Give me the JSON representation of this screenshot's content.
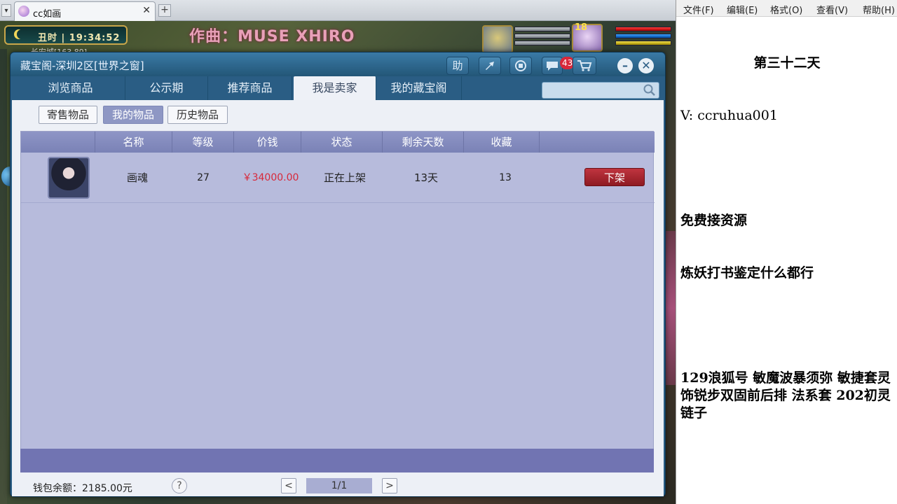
{
  "browser": {
    "tab_title": "cc如画",
    "tab_close": "✕",
    "new_tab": "+"
  },
  "game": {
    "clock": "丑时 | 19:34:52",
    "location": "长安城[163,89]",
    "banner": "作曲：MUSE XHIRO",
    "player_level": "18"
  },
  "window": {
    "title": "藏宝阁-深圳2区[世界之窗]",
    "toolbar": {
      "help_label": "助",
      "chat_badge": "43"
    },
    "tabs": [
      "浏览商品",
      "公示期",
      "推荐商品",
      "我是卖家",
      "我的藏宝阁"
    ],
    "active_tab": "我是卖家",
    "search_placeholder": "",
    "subtabs": [
      "寄售物品",
      "我的物品",
      "历史物品"
    ],
    "active_subtab": "我的物品",
    "table": {
      "headers": [
        "名称",
        "等级",
        "价钱",
        "状态",
        "剩余天数",
        "收藏"
      ],
      "rows": [
        {
          "name": "画魂",
          "level": "27",
          "price": "￥34000.00",
          "status": "正在上架",
          "days_left": "13天",
          "favorites": "13",
          "action": "下架"
        }
      ]
    },
    "footer": {
      "wallet": "钱包余额：2185.00元",
      "help": "?",
      "prev": "<",
      "page": "1/1",
      "next": ">"
    }
  },
  "notepad": {
    "menu": [
      "文件(F)",
      "编辑(E)",
      "格式(O)",
      "查看(V)",
      "帮助(H)"
    ],
    "title": "第三十二天",
    "lines": [
      "V: ccruhua001",
      "",
      "免费接资源",
      "炼妖打书鉴定什么都行",
      "",
      "129浪狐号 敏魔波暴须弥 敏捷套灵饰锐步双固前后排 法系套 202初灵链子"
    ]
  },
  "colors": {
    "price_red": "#d8283a",
    "delist_red": "#b02a35",
    "window_blue": "#2a5d84",
    "table_purple": "#b7bbdc"
  }
}
